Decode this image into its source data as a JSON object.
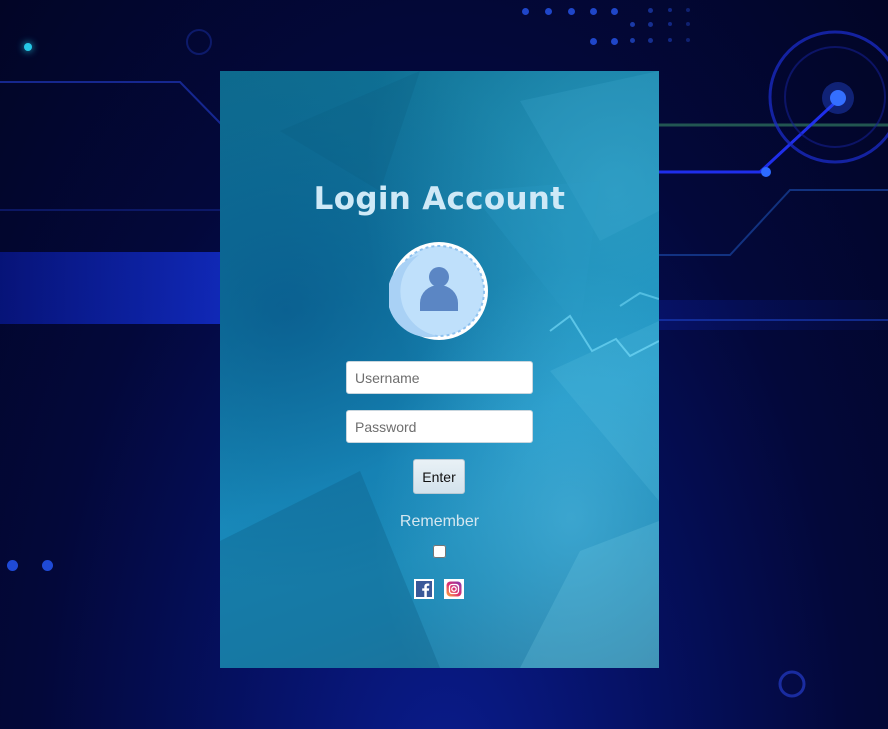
{
  "login": {
    "title": "Login Account",
    "username_placeholder": "Username",
    "password_placeholder": "Password",
    "enter_label": "Enter",
    "remember_label": "Remember",
    "remember_checked": false
  },
  "avatar": {
    "icon": "user-avatar-icon"
  },
  "social": [
    {
      "name": "facebook",
      "icon": "facebook-icon"
    },
    {
      "name": "instagram",
      "icon": "instagram-icon"
    }
  ],
  "colors": {
    "page_background": "#03083a",
    "card_background": "#1a8fbf",
    "title_text": "#cfe9f7",
    "facebook_blue": "#3b5998",
    "avatar_blue": "#5b86c4"
  }
}
